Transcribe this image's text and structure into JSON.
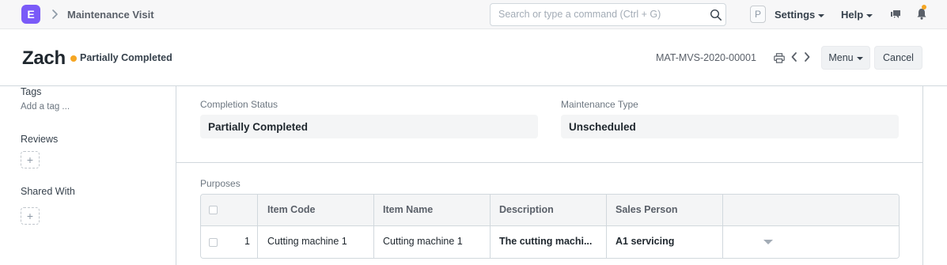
{
  "navbar": {
    "logo_letter": "E",
    "breadcrumb": "Maintenance Visit",
    "search_placeholder": "Search or type a command (Ctrl + G)",
    "avatar_letter": "P",
    "settings_label": "Settings",
    "help_label": "Help"
  },
  "page_head": {
    "title": "Zach",
    "status": "Partially Completed",
    "doc_id": "MAT-MVS-2020-00001",
    "menu_label": "Menu",
    "cancel_label": "Cancel"
  },
  "sidebar": {
    "tags_label": "Tags",
    "add_tag": "Add a tag ...",
    "reviews_label": "Reviews",
    "shared_with_label": "Shared With",
    "add_symbol": "+"
  },
  "form": {
    "completion_status_label": "Completion Status",
    "completion_status_value": "Partially Completed",
    "maintenance_type_label": "Maintenance Type",
    "maintenance_type_value": "Unscheduled",
    "purposes_label": "Purposes"
  },
  "purposes_table": {
    "columns": [
      "Item Code",
      "Item Name",
      "Description",
      "Sales Person"
    ],
    "rows": [
      {
        "index": "1",
        "item_code": "Cutting machine 1",
        "item_name": "Cutting machine 1",
        "description": "The cutting machi...",
        "sales_person": "A1 servicing"
      }
    ]
  },
  "colors": {
    "accent": "#7a5af8",
    "status_indicator": "#f5a623"
  }
}
